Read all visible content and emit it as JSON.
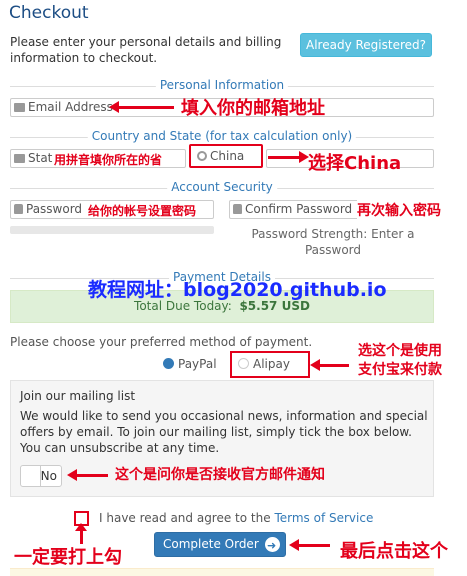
{
  "header": {
    "title": "Checkout"
  },
  "intro": {
    "text": "Please enter your personal details and billing information to checkout.",
    "already_registered": "Already Registered?"
  },
  "personal": {
    "section_label": "Personal Information",
    "email_placeholder": "Email Address",
    "annot_email": "填入你的邮箱地址"
  },
  "country": {
    "section_label": "Country and State (for tax calculation only)",
    "state_placeholder": "Stat",
    "annot_state": "用拼音填你所在的省",
    "country_value": "China",
    "annot_country": "选择China"
  },
  "security": {
    "section_label": "Account Security",
    "password_placeholder": "Password",
    "annot_password": "给你的帐号设置密码",
    "confirm_placeholder": "Confirm Password",
    "annot_confirm": "再次输入密码",
    "strength_text": "Password Strength: Enter a Password"
  },
  "payment": {
    "section_label": "Payment Details",
    "total_label": "Total Due Today:",
    "total_value": "$5.57 USD",
    "tutorial_url": "教程网址：blog2020.github.io",
    "method_prompt": "Please choose your preferred method of payment.",
    "option_paypal": "PayPal",
    "option_alipay": "Alipay",
    "annot_alipay_1": "选这个是使用",
    "annot_alipay_2": "支付宝来付款"
  },
  "mailing": {
    "title": "Join our mailing list",
    "body": "We would like to send you occasional news, information and special offers by email. To join our mailing list, simply tick the box below. You can unsubscribe at any time.",
    "toggle_value": "No",
    "annot_toggle": "这个是问你是否接收官方邮件通知"
  },
  "terms": {
    "prefix": "I have read and agree to the",
    "link": "Terms of Service",
    "annot_check": "一定要打上勾",
    "complete_button": "Complete Order",
    "annot_complete": "最后点击这个"
  },
  "colors": {
    "annotation_red": "#e3001b",
    "link_blue": "#337ab7",
    "success_green": "#dff0d8",
    "info_blue": "#5bc0de"
  }
}
